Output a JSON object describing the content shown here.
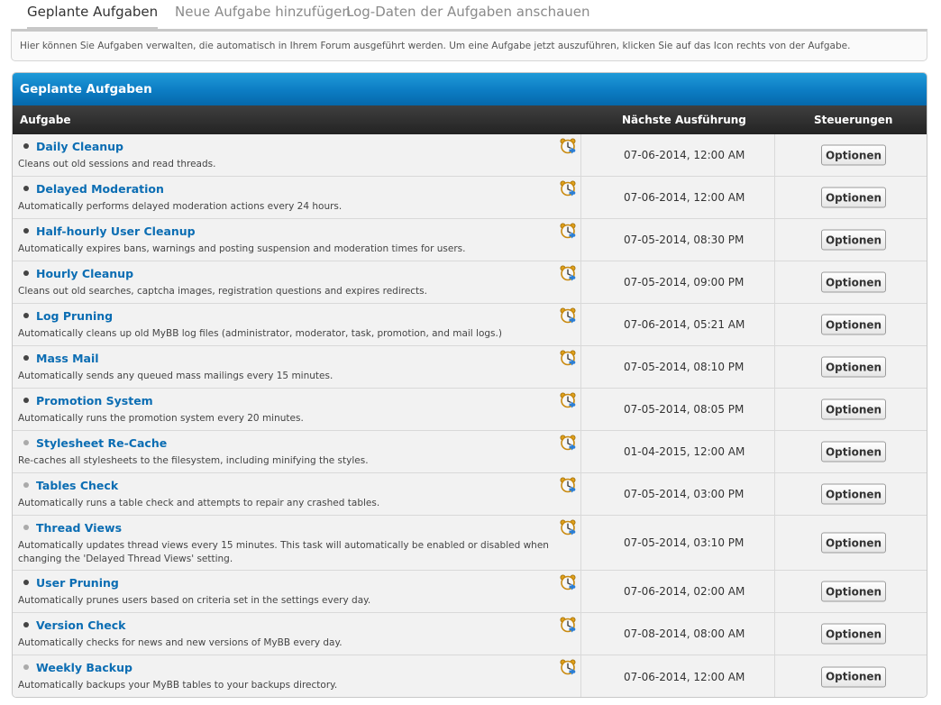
{
  "tabs": [
    {
      "label": "Geplante Aufgaben",
      "active": true
    },
    {
      "label": "Neue Aufgabe hinzufügen",
      "active": false
    },
    {
      "label": "Log-Daten der Aufgaben anschauen",
      "active": false
    }
  ],
  "info": {
    "text": "Hier können Sie Aufgaben verwalten, die automatisch in Ihrem Forum ausgeführt werden. Um eine Aufgabe jetzt auszuführen, klicken Sie auf das Icon rechts von der Aufgabe."
  },
  "panel": {
    "title": "Geplante Aufgaben",
    "columns": {
      "task": "Aufgabe",
      "next_run": "Nächste Ausführung",
      "controls": "Steuerungen"
    }
  },
  "colors": {
    "accent": "#0b6db3",
    "header_blue": "#0c7cc3",
    "header_dark": "#2d2d2d"
  },
  "tasks": [
    {
      "name": "Daily Cleanup",
      "description": "Cleans out old sessions and read threads.",
      "next_run": "07-06-2014, 12:00 AM",
      "button": "Optionen",
      "enabled": true,
      "icon": "clock-run-icon"
    },
    {
      "name": "Delayed Moderation",
      "description": "Automatically performs delayed moderation actions every 24 hours.",
      "next_run": "07-06-2014, 12:00 AM",
      "button": "Optionen",
      "enabled": true,
      "icon": "clock-run-icon"
    },
    {
      "name": "Half-hourly User Cleanup",
      "description": "Automatically expires bans, warnings and posting suspension and moderation times for users.",
      "next_run": "07-05-2014, 08:30 PM",
      "button": "Optionen",
      "enabled": true,
      "icon": "clock-run-icon"
    },
    {
      "name": "Hourly Cleanup",
      "description": "Cleans out old searches, captcha images, registration questions and expires redirects.",
      "next_run": "07-05-2014, 09:00 PM",
      "button": "Optionen",
      "enabled": true,
      "icon": "clock-run-icon"
    },
    {
      "name": "Log Pruning",
      "description": "Automatically cleans up old MyBB log files (administrator, moderator, task, promotion, and mail logs.)",
      "next_run": "07-06-2014, 05:21 AM",
      "button": "Optionen",
      "enabled": true,
      "icon": "clock-run-icon"
    },
    {
      "name": "Mass Mail",
      "description": "Automatically sends any queued mass mailings every 15 minutes.",
      "next_run": "07-05-2014, 08:10 PM",
      "button": "Optionen",
      "enabled": true,
      "icon": "clock-run-icon"
    },
    {
      "name": "Promotion System",
      "description": "Automatically runs the promotion system every 20 minutes.",
      "next_run": "07-05-2014, 08:05 PM",
      "button": "Optionen",
      "enabled": true,
      "icon": "clock-run-icon"
    },
    {
      "name": "Stylesheet Re-Cache",
      "description": "Re-caches all stylesheets to the filesystem, including minifying the styles.",
      "next_run": "01-04-2015, 12:00 AM",
      "button": "Optionen",
      "enabled": false,
      "icon": "clock-run-icon"
    },
    {
      "name": "Tables Check",
      "description": "Automatically runs a table check and attempts to repair any crashed tables.",
      "next_run": "07-05-2014, 03:00 PM",
      "button": "Optionen",
      "enabled": false,
      "icon": "clock-run-icon"
    },
    {
      "name": "Thread Views",
      "description": "Automatically updates thread views every 15 minutes. This task will automatically be enabled or disabled when changing the 'Delayed Thread Views' setting.",
      "next_run": "07-05-2014, 03:10 PM",
      "button": "Optionen",
      "enabled": false,
      "icon": "clock-run-icon"
    },
    {
      "name": "User Pruning",
      "description": "Automatically prunes users based on criteria set in the settings every day.",
      "next_run": "07-06-2014, 02:00 AM",
      "button": "Optionen",
      "enabled": true,
      "icon": "clock-run-icon"
    },
    {
      "name": "Version Check",
      "description": "Automatically checks for news and new versions of MyBB every day.",
      "next_run": "07-08-2014, 08:00 AM",
      "button": "Optionen",
      "enabled": true,
      "icon": "clock-run-icon"
    },
    {
      "name": "Weekly Backup",
      "description": "Automatically backups your MyBB tables to your backups directory.",
      "next_run": "07-06-2014, 12:00 AM",
      "button": "Optionen",
      "enabled": false,
      "icon": "clock-run-icon"
    }
  ]
}
